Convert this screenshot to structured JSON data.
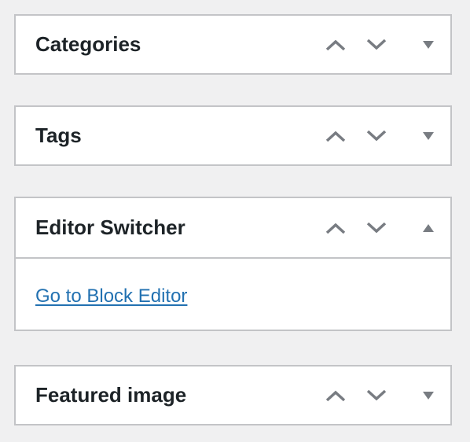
{
  "colors": {
    "background": "#f0f0f1",
    "box_border": "#c3c4c7",
    "title": "#1d2327",
    "icon": "#787c82",
    "link": "#2271b1"
  },
  "boxes": [
    {
      "title": "Categories",
      "state": "collapsed",
      "actions": {
        "move_up": "chevron-up-icon",
        "move_down": "chevron-down-icon",
        "toggle": "triangle-down-icon"
      }
    },
    {
      "title": "Tags",
      "state": "collapsed",
      "actions": {
        "move_up": "chevron-up-icon",
        "move_down": "chevron-down-icon",
        "toggle": "triangle-down-icon"
      }
    },
    {
      "title": "Editor Switcher",
      "state": "expanded",
      "link": "Go to Block Editor",
      "actions": {
        "move_up": "chevron-up-icon",
        "move_down": "chevron-down-icon",
        "toggle": "triangle-up-icon"
      }
    },
    {
      "title": "Featured image",
      "state": "collapsed",
      "actions": {
        "move_up": "chevron-up-icon",
        "move_down": "chevron-down-icon",
        "toggle": "triangle-down-icon"
      }
    }
  ]
}
